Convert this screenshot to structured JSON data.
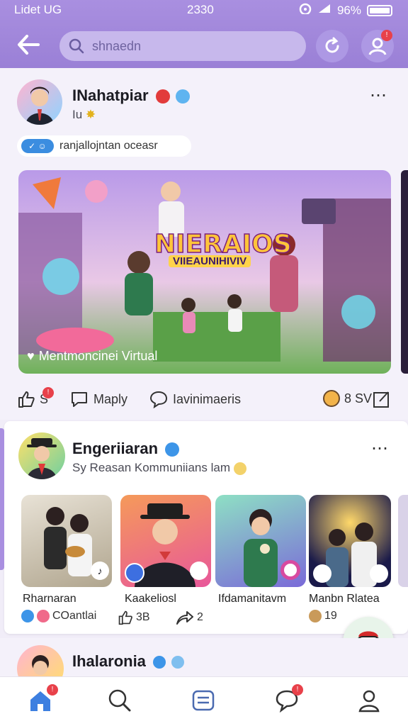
{
  "status": {
    "carrier": "Lidet UG",
    "time": "2330",
    "battery": "96%"
  },
  "search": {
    "placeholder": "shnaedn"
  },
  "post1": {
    "name": "INahatpiar",
    "sub": "Iu",
    "tag": "ranjallojntan oceasr",
    "hero_title": "NIERAIOS",
    "hero_subtitle": "VIIEAUNIHIVIV",
    "hero_caption": "Mentmoncinei Virtual",
    "actions": {
      "likes": "S",
      "reply": "Maply",
      "comments": "Iavinimaeris",
      "share_count": "8 SV"
    }
  },
  "post2": {
    "name": "Engeriiaran",
    "sub": "Sy Reasan Kommuniians lam",
    "thumbs": [
      {
        "label": "Rharnaran"
      },
      {
        "label": "Kaakeliosl"
      },
      {
        "label": "Ifdamanitavm"
      },
      {
        "label": "Manbn Rlatea"
      }
    ],
    "footer": {
      "label": "COantlai",
      "likes": "3B",
      "shares": "2",
      "extra": "19"
    }
  },
  "post3": {
    "name": "Ihalaronia"
  },
  "nav": [
    "home-tab",
    "search-tab",
    "feed-tab",
    "messages-tab",
    "profile-tab"
  ]
}
